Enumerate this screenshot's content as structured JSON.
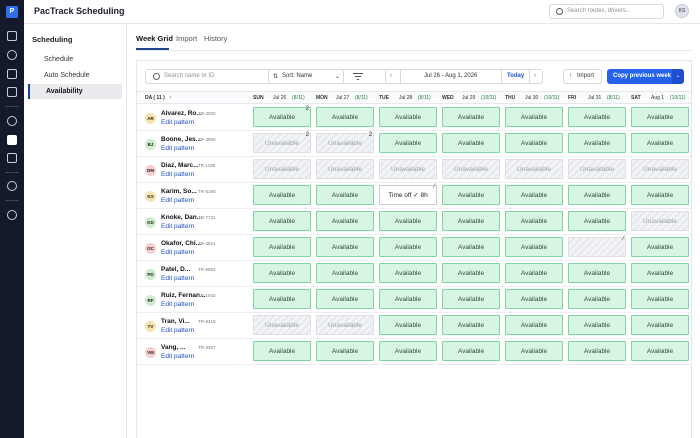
{
  "app": {
    "title": "PacTrack Scheduling",
    "logo_letter": "P"
  },
  "global_search": {
    "placeholder": "Search routes, drivers..."
  },
  "user": {
    "initials": "KS"
  },
  "rail_icons": [
    "route-icon",
    "chat-icon",
    "truck-icon",
    "box-icon",
    "gauge-icon",
    "calendar-icon",
    "clipboard-icon",
    "dollar-icon",
    "settings-icon"
  ],
  "sidebar": {
    "title": "Scheduling",
    "items": [
      {
        "label": "Schedule",
        "active": false
      },
      {
        "label": "Auto Schedule",
        "active": false
      },
      {
        "label": "Availability",
        "active": true
      }
    ]
  },
  "tabs": [
    {
      "label": "Week Grid",
      "active": true
    },
    {
      "label": "Import",
      "active": false
    },
    {
      "label": "History",
      "active": false
    }
  ],
  "toolbar": {
    "search_placeholder": "Search name or ID",
    "sort_label": "Sort: Name",
    "date_range": "Jul 26 - Aug 1, 2026",
    "today_label": "Today",
    "import_label": "Import",
    "copy_label": "Copy previous week"
  },
  "grid": {
    "driver_header": "DA ( 11 )",
    "sort_arrow": "↑",
    "days": [
      {
        "day": "SUN",
        "date": "Jul 26",
        "count": "(8/11)"
      },
      {
        "day": "MON",
        "date": "Jul 27",
        "count": "(8/11)"
      },
      {
        "day": "TUE",
        "date": "Jul 28",
        "count": "(8/11)"
      },
      {
        "day": "WED",
        "date": "Jul 29",
        "count": "(10/11)"
      },
      {
        "day": "THU",
        "date": "Jul 30",
        "count": "(10/11)"
      },
      {
        "day": "FRI",
        "date": "Jul 31",
        "count": "(8/11)"
      },
      {
        "day": "SAT",
        "date": "Aug 1",
        "count": "(10/11)"
      }
    ],
    "edit_label": "Edit pattern",
    "rows": [
      {
        "initials": "AR",
        "color": "#f6e3b0",
        "name": "Alvarez, Ro...",
        "id": "TR-4003",
        "cells": [
          {
            "status": "available",
            "label": "Available",
            "mark": "2"
          },
          {
            "status": "available",
            "label": "Available",
            "mark": ""
          },
          {
            "status": "available",
            "label": "Available",
            "mark": ""
          },
          {
            "status": "available",
            "label": "Available",
            "mark": ""
          },
          {
            "status": "available",
            "label": "Available",
            "mark": ""
          },
          {
            "status": "available",
            "label": "Available",
            "mark": ""
          },
          {
            "status": "available",
            "label": "Available",
            "mark": ""
          }
        ]
      },
      {
        "initials": "BJ",
        "color": "#cdeccd",
        "name": "Boone, Jes...",
        "id": "TR-3890",
        "cells": [
          {
            "status": "unavailable",
            "label": "Unavailable",
            "mark": "2"
          },
          {
            "status": "unavailable",
            "label": "Unavailable",
            "mark": "2"
          },
          {
            "status": "available",
            "label": "Available",
            "mark": ""
          },
          {
            "status": "available",
            "label": "Available",
            "mark": ""
          },
          {
            "status": "available",
            "label": "Available",
            "mark": ""
          },
          {
            "status": "available",
            "label": "Available",
            "mark": ""
          },
          {
            "status": "available",
            "label": "Available",
            "mark": ""
          }
        ]
      },
      {
        "initials": "DM",
        "color": "#f7cfcf",
        "name": "Diaz, Marc...",
        "id": "TR-1198",
        "cells": [
          {
            "status": "unavailable",
            "label": "Unavailable",
            "mark": ""
          },
          {
            "status": "unavailable",
            "label": "Unavailable",
            "mark": ""
          },
          {
            "status": "unavailable",
            "label": "Unavailable",
            "mark": ""
          },
          {
            "status": "unavailable",
            "label": "Unavailable",
            "mark": ""
          },
          {
            "status": "unavailable",
            "label": "Unavailable",
            "mark": ""
          },
          {
            "status": "unavailable",
            "label": "Unavailable",
            "mark": ""
          },
          {
            "status": "unavailable",
            "label": "Unavailable",
            "mark": ""
          }
        ]
      },
      {
        "initials": "KS",
        "color": "#f6e3b0",
        "name": "Karim, So...",
        "id": "TR-5190",
        "cells": [
          {
            "status": "available",
            "label": "Available",
            "mark": ""
          },
          {
            "status": "available",
            "label": "Available",
            "mark": ""
          },
          {
            "status": "timeoff",
            "label": "Time off ✓ 8h",
            "mark": "⁄"
          },
          {
            "status": "available",
            "label": "Available",
            "mark": ""
          },
          {
            "status": "available",
            "label": "Available",
            "mark": ""
          },
          {
            "status": "available",
            "label": "Available",
            "mark": ""
          },
          {
            "status": "available",
            "label": "Available",
            "mark": ""
          }
        ]
      },
      {
        "initials": "KD",
        "color": "#cdeccd",
        "name": "Knoke, Dan...",
        "id": "TR-7731",
        "cells": [
          {
            "status": "available",
            "label": "Available",
            "mark": ""
          },
          {
            "status": "available",
            "label": "Available",
            "mark": ""
          },
          {
            "status": "available",
            "label": "Available",
            "mark": ""
          },
          {
            "status": "available",
            "label": "Available",
            "mark": ""
          },
          {
            "status": "available",
            "label": "Available",
            "mark": ""
          },
          {
            "status": "available",
            "label": "Available",
            "mark": ""
          },
          {
            "status": "unavailable",
            "label": "Unavailable",
            "mark": ""
          }
        ]
      },
      {
        "initials": "OC",
        "color": "#f7cfcf",
        "name": "Okafor, Chi...",
        "id": "TR-4821",
        "cells": [
          {
            "status": "available",
            "label": "Available",
            "mark": ""
          },
          {
            "status": "available",
            "label": "Available",
            "mark": ""
          },
          {
            "status": "available",
            "label": "Available",
            "mark": ""
          },
          {
            "status": "available",
            "label": "Available",
            "mark": ""
          },
          {
            "status": "available",
            "label": "Available",
            "mark": ""
          },
          {
            "status": "unavailable",
            "label": "",
            "mark": "⁄"
          },
          {
            "status": "available",
            "label": "Available",
            "mark": ""
          }
        ]
      },
      {
        "initials": "PD",
        "color": "#cdeccd",
        "name": "Patel, D...",
        "id": "TR-8954",
        "cells": [
          {
            "status": "available",
            "label": "Available",
            "mark": ""
          },
          {
            "status": "available",
            "label": "Available",
            "mark": ""
          },
          {
            "status": "available",
            "label": "Available",
            "mark": ""
          },
          {
            "status": "available",
            "label": "Available",
            "mark": ""
          },
          {
            "status": "available",
            "label": "Available",
            "mark": ""
          },
          {
            "status": "available",
            "label": "Available",
            "mark": ""
          },
          {
            "status": "available",
            "label": "Available",
            "mark": ""
          }
        ]
      },
      {
        "initials": "RF",
        "color": "#cdeccd",
        "name": "Ruiz, Fernan...",
        "id": "TR-1042",
        "cells": [
          {
            "status": "available",
            "label": "Available",
            "mark": ""
          },
          {
            "status": "available",
            "label": "Available",
            "mark": ""
          },
          {
            "status": "available",
            "label": "Available",
            "mark": ""
          },
          {
            "status": "available",
            "label": "Available",
            "mark": ""
          },
          {
            "status": "available",
            "label": "Available",
            "mark": ""
          },
          {
            "status": "available",
            "label": "Available",
            "mark": ""
          },
          {
            "status": "available",
            "label": "Available",
            "mark": ""
          }
        ]
      },
      {
        "initials": "TV",
        "color": "#f6e3b0",
        "name": "Tran, Vi...",
        "id": "TR-8419",
        "cells": [
          {
            "status": "unavailable",
            "label": "Unavailable",
            "mark": ""
          },
          {
            "status": "unavailable",
            "label": "Unavailable",
            "mark": ""
          },
          {
            "status": "available",
            "label": "Available",
            "mark": ""
          },
          {
            "status": "available",
            "label": "Available",
            "mark": ""
          },
          {
            "status": "available",
            "label": "Available",
            "mark": ""
          },
          {
            "status": "available",
            "label": "Available",
            "mark": ""
          },
          {
            "status": "available",
            "label": "Available",
            "mark": ""
          }
        ]
      },
      {
        "initials": "VM",
        "color": "#f7cfcf",
        "name": "Vang, ...",
        "id": "TR-3307",
        "cells": [
          {
            "status": "available",
            "label": "Available",
            "mark": ""
          },
          {
            "status": "available",
            "label": "Available",
            "mark": ""
          },
          {
            "status": "available",
            "label": "Available",
            "mark": ""
          },
          {
            "status": "available",
            "label": "Available",
            "mark": ""
          },
          {
            "status": "available",
            "label": "Available",
            "mark": ""
          },
          {
            "status": "available",
            "label": "Available",
            "mark": ""
          },
          {
            "status": "available",
            "label": "Available",
            "mark": ""
          }
        ]
      }
    ]
  },
  "colors": {
    "accent": "#2563eb",
    "available_bg": "#d7f5e3",
    "available_border": "#7fd6a4",
    "rail_bg": "#141a2b",
    "count_green": "#1f7a3f"
  }
}
